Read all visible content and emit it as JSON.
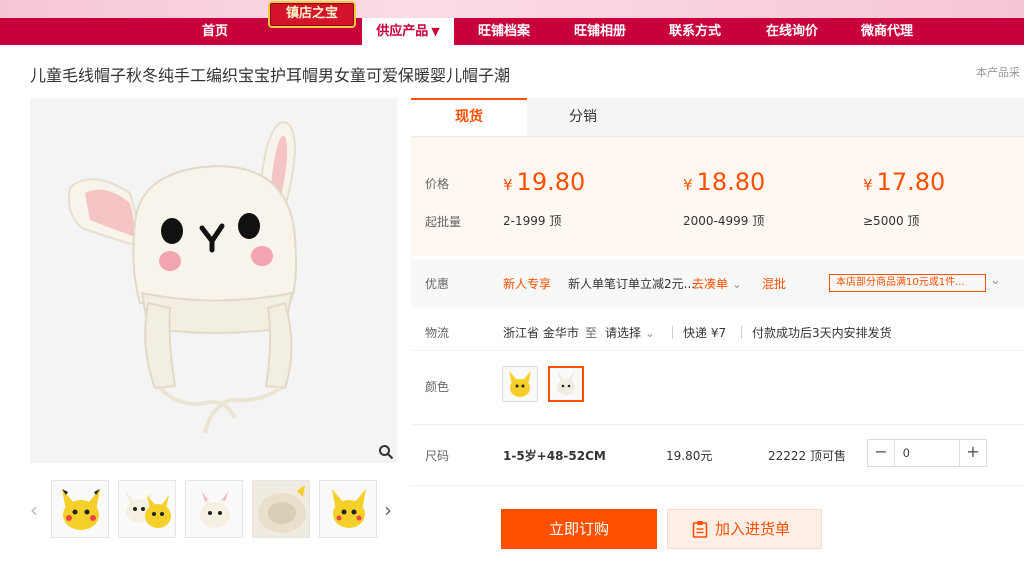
{
  "nav": {
    "items": [
      "首页",
      "旺铺档案",
      "旺铺相册",
      "联系方式",
      "在线询价",
      "微商代理"
    ],
    "badge": "镇店之宝",
    "active": "供应产品",
    "active_caret": "▼"
  },
  "product": {
    "title": "儿童毛线帽子秋冬纯手工编织宝宝护耳帽男女童可爱保暖婴儿帽子潮",
    "note": "本产品采"
  },
  "tabs": [
    "现货",
    "分销"
  ],
  "pricing": {
    "price_label": "价格",
    "moq_label": "起批量",
    "currency": "¥",
    "tiers": [
      {
        "price": "19.80",
        "range": "2-1999 顶"
      },
      {
        "price": "18.80",
        "range": "2000-4999 顶"
      },
      {
        "price": "17.80",
        "range": "≥5000 顶"
      }
    ]
  },
  "promo": {
    "label": "优惠",
    "tag": "新人专享",
    "text": "新人单笔订单立减2元...",
    "link": "去凑单",
    "mixed": "混批",
    "stamp": "本店部分商品满10元或1件..."
  },
  "logistics": {
    "label": "物流",
    "from": "浙江省 金华市",
    "to_word": "至",
    "select": "请选择",
    "express": "快递 ¥7",
    "ship": "付款成功后3天内安排发货"
  },
  "color": {
    "label": "颜色",
    "options": [
      "pikachu",
      "rabbit"
    ]
  },
  "size": {
    "label": "尺码",
    "value": "1-5岁+48-52CM",
    "price": "19.80元",
    "stock": "22222 顶可售",
    "qty": "0"
  },
  "actions": {
    "order": "立即订购",
    "cart": "加入进货单"
  },
  "colors": {
    "brand": "#c8003c",
    "accent": "#ff5000"
  }
}
